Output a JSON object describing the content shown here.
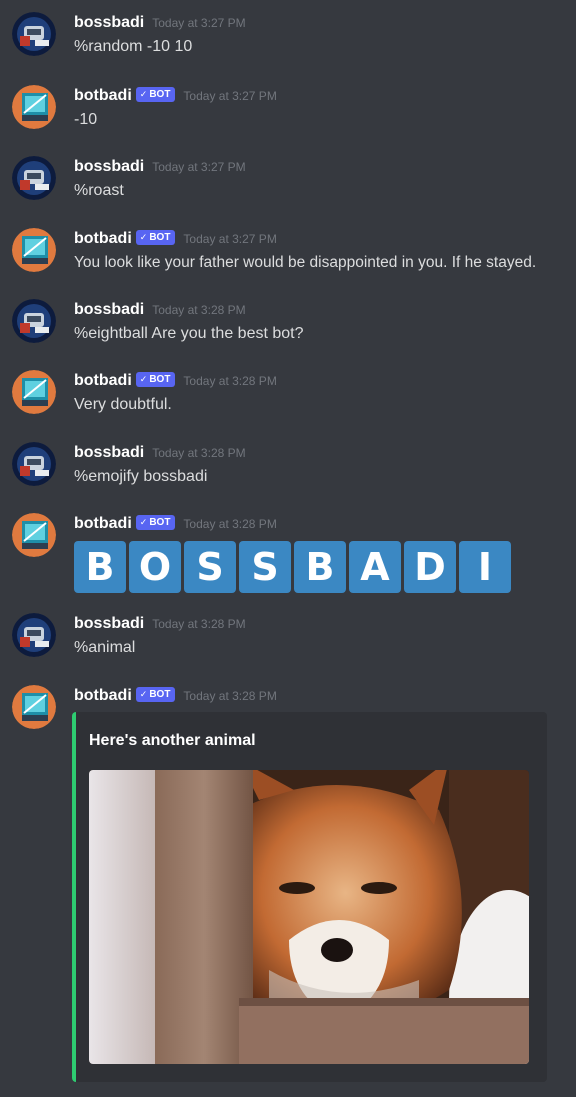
{
  "users": {
    "human": {
      "name": "bossbadi"
    },
    "bot": {
      "name": "botbadi",
      "tag": "BOT"
    }
  },
  "messages": [
    {
      "author": "bossbadi",
      "time": "Today at 3:27 PM",
      "text": "%random -10 10"
    },
    {
      "author": "botbadi",
      "time": "Today at 3:27 PM",
      "text": "-10"
    },
    {
      "author": "bossbadi",
      "time": "Today at 3:27 PM",
      "text": "%roast"
    },
    {
      "author": "botbadi",
      "time": "Today at 3:27 PM",
      "text": "You look like your father would be disappointed in you. If he stayed."
    },
    {
      "author": "bossbadi",
      "time": "Today at 3:28 PM",
      "text": "%eightball Are you the best bot?"
    },
    {
      "author": "botbadi",
      "time": "Today at 3:28 PM",
      "text": "Very doubtful."
    },
    {
      "author": "bossbadi",
      "time": "Today at 3:28 PM",
      "text": "%emojify bossbadi"
    },
    {
      "author": "botbadi",
      "time": "Today at 3:28 PM",
      "emoji_letters": [
        "B",
        "O",
        "S",
        "S",
        "B",
        "A",
        "D",
        "I"
      ]
    },
    {
      "author": "bossbadi",
      "time": "Today at 3:28 PM",
      "text": "%animal"
    },
    {
      "author": "botbadi",
      "time": "Today at 3:28 PM",
      "embed": {
        "title": "Here's another animal",
        "accent": "#2ecc71",
        "image": "fox-photo"
      }
    }
  ],
  "colors": {
    "background": "#36393f",
    "embed_bg": "#2f3136",
    "bot_tag": "#5865f2",
    "emoji_tile": "#3b88c3",
    "embed_accent": "#2ecc71"
  }
}
